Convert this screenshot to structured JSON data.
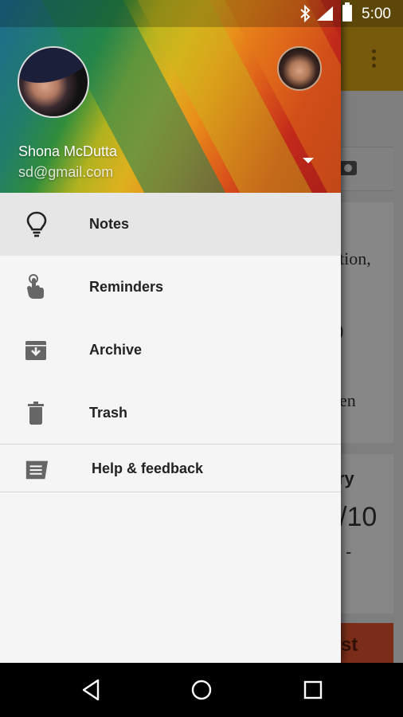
{
  "status_bar": {
    "time": "5:00"
  },
  "account": {
    "name": "Shona McDutta",
    "email": "sd@gmail.com"
  },
  "menu": {
    "items": [
      {
        "label": "Notes",
        "icon": "lightbulb-icon",
        "active": true
      },
      {
        "label": "Reminders",
        "icon": "reminder-finger-icon",
        "active": false
      },
      {
        "label": "Archive",
        "icon": "archive-icon",
        "active": false
      },
      {
        "label": "Trash",
        "icon": "trash-icon",
        "active": false
      }
    ],
    "help": {
      "label": "Help & feedback",
      "icon": "feedback-icon"
    }
  },
  "background_app": {
    "fragments": [
      "tion,",
      ")",
      "en",
      "ry",
      "/10",
      "-",
      "st"
    ]
  },
  "colors": {
    "toolbar": "#d9a514",
    "drawer_bg": "#f5f5f5",
    "active_item": "#e6e6e6",
    "accent_red": "#e0532f"
  }
}
